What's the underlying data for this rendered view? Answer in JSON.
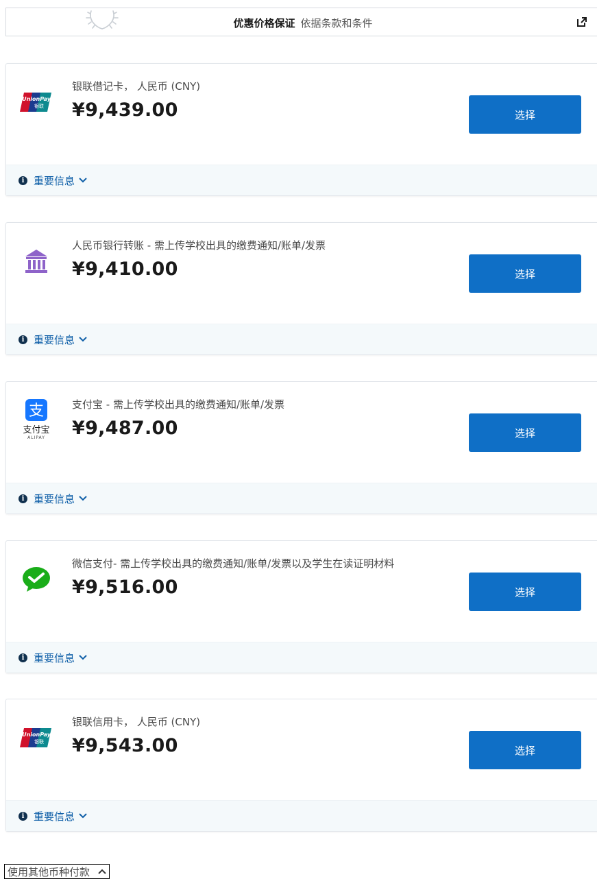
{
  "banner": {
    "title": "优惠价格保证",
    "subtitle": "依据条款和条件"
  },
  "payment_options": [
    {
      "logo": "unionpay-logo",
      "method": "银联借记卡， 人民币 (CNY)",
      "price": "¥9,439.00",
      "select_label": "选择",
      "info_label": "重要信息"
    },
    {
      "logo": "bank-icon",
      "method": "人民币银行转账 - 需上传学校出具的缴费通知/账单/发票",
      "price": "¥9,410.00",
      "select_label": "选择",
      "info_label": "重要信息"
    },
    {
      "logo": "alipay-logo",
      "method": "支付宝 - 需上传学校出具的缴费通知/账单/发票",
      "price": "¥9,487.00",
      "select_label": "选择",
      "info_label": "重要信息"
    },
    {
      "logo": "wechat-pay-logo",
      "method": "微信支付- 需上传学校出具的缴费通知/账单/发票以及学生在读证明材料",
      "price": "¥9,516.00",
      "select_label": "选择",
      "info_label": "重要信息"
    },
    {
      "logo": "unionpay-logo",
      "method": "银联信用卡， 人民币 (CNY)",
      "price": "¥9,543.00",
      "select_label": "选择",
      "info_label": "重要信息"
    }
  ],
  "alipay_logo_text": {
    "cn": "支付宝",
    "en": "ALIPAY"
  },
  "other_currency_label": "使用其他币种付款",
  "colors": {
    "button_blue": "#0f6fc6",
    "info_link": "#0f5fa8",
    "info_bar_bg": "#f4f9fb"
  }
}
